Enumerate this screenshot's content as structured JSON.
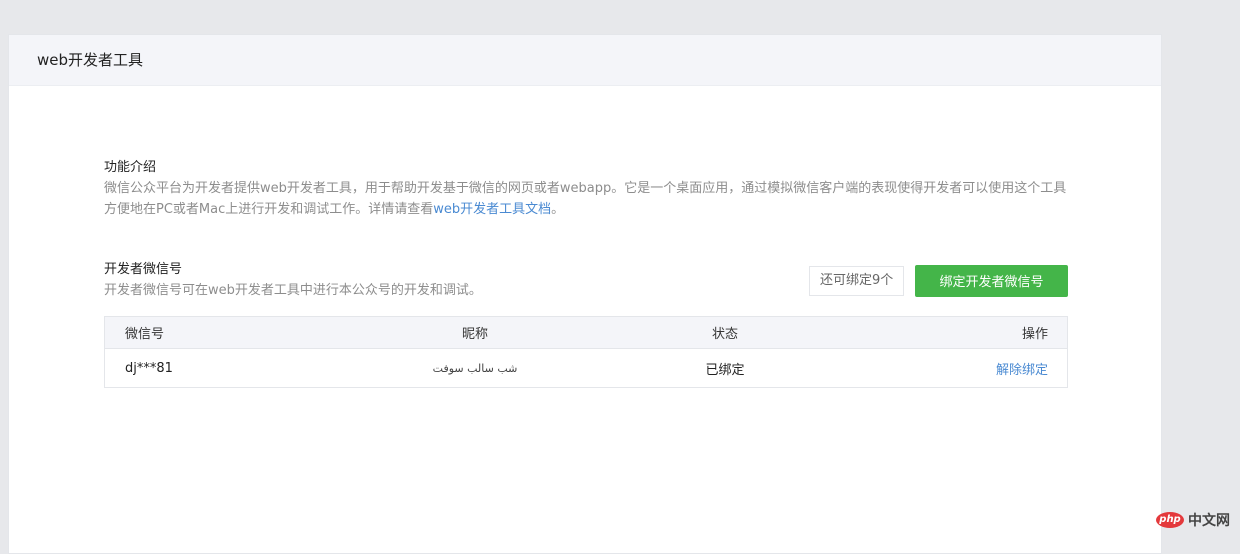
{
  "header": {
    "title": "web开发者工具"
  },
  "intro": {
    "title": "功能介绍",
    "desc_part1": "微信公众平台为开发者提供web开发者工具，用于帮助开发基于微信的网页或者webapp。它是一个桌面应用，通过模拟微信客户端的表现使得开发者可以使用这个工具方便地在PC或者Mac上进行开发和调试工作。详情请查看",
    "doc_link": "web开发者工具文档",
    "desc_part2": "。"
  },
  "dev": {
    "title": "开发者微信号",
    "desc": "开发者微信号可在web开发者工具中进行本公众号的开发和调试。",
    "remain_label": "还可绑定9个",
    "bind_button": "绑定开发者微信号"
  },
  "table": {
    "columns": [
      "微信号",
      "昵称",
      "状态",
      "操作"
    ],
    "rows": [
      {
        "wechat_id": "dj***81",
        "nickname": "شب سالب سوفت",
        "status": "已绑定",
        "action": "解除绑定"
      }
    ]
  },
  "watermark": {
    "logo": "php",
    "text": "中文网"
  },
  "colors": {
    "accent_green": "#44b549",
    "link_blue": "#4a8ad2",
    "background": "#e7e8eb"
  }
}
